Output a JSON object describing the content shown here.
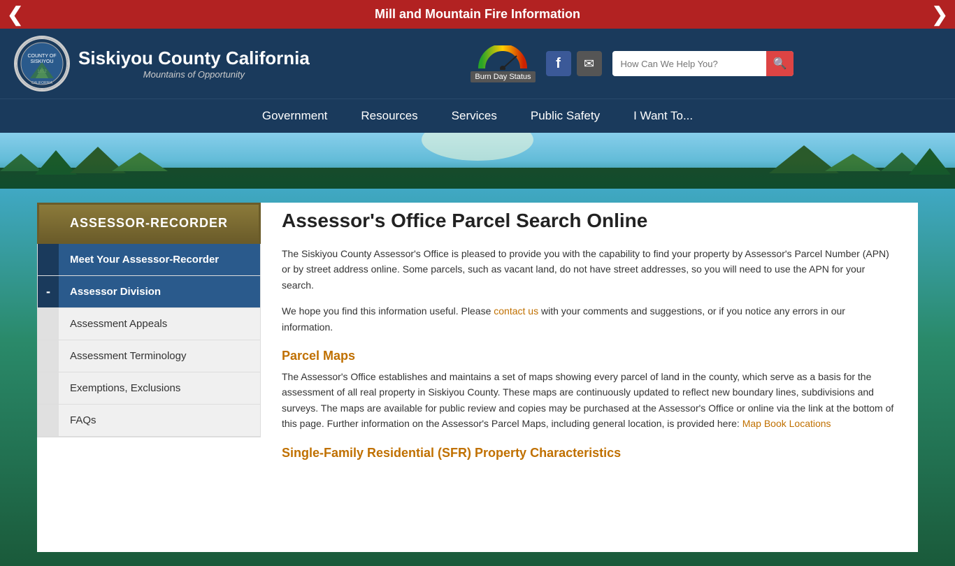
{
  "topBanner": {
    "text": "Mill and Mountain Fire Information",
    "arrowLeft": "❮",
    "arrowRight": "❯"
  },
  "header": {
    "siteTitle": "Siskiyou County California",
    "subtitle": "Mountains of Opportunity",
    "burnDayLabel": "Burn Day Status",
    "searchPlaceholder": "How Can We Help You?",
    "facebookLabel": "f",
    "emailLabel": "✉"
  },
  "nav": {
    "items": [
      {
        "label": "Government"
      },
      {
        "label": "Resources"
      },
      {
        "label": "Services"
      },
      {
        "label": "Public Safety"
      },
      {
        "label": "I Want To..."
      }
    ]
  },
  "sidebar": {
    "header": "ASSESSOR-RECORDER",
    "meetItem": "Meet Your Assessor-Recorder",
    "assessorDivisionLabel": "Assessor Division",
    "assessorDivisionIndicator": "-",
    "subItems": [
      {
        "label": "Assessment Appeals"
      },
      {
        "label": "Assessment Terminology"
      },
      {
        "label": "Exemptions, Exclusions"
      },
      {
        "label": "FAQs"
      }
    ]
  },
  "content": {
    "title": "Assessor's Office Parcel Search Online",
    "intro1": "The Siskiyou County Assessor's Office is pleased to provide you with the capability to find your property by Assessor's Parcel Number (APN) or by street address online. Some parcels, such as vacant land, do not have street addresses, so you will need to use the APN for your search.",
    "intro2": "We hope you find this information useful. Please",
    "contactLinkText": "contact us",
    "intro2b": "with your comments and suggestions, or if you notice any errors in our information.",
    "parcelMapsTitle": "Parcel Maps",
    "parcelMapsBody": "The Assessor's Office establishes and maintains a set of maps showing every parcel of land in the county, which serve as a basis for the assessment of all real property in Siskiyou County. These maps are continuously updated to reflect new boundary lines, subdivisions and surveys. The maps are available for public review and copies may be purchased at the Assessor's Office or online via the link at the bottom of this page. Further information on the Assessor's Parcel Maps, including general location, is provided here:",
    "mapBookLinkText": "Map Book Locations",
    "sfrTitle": "Single-Family Residential (SFR) Property Characteristics"
  }
}
